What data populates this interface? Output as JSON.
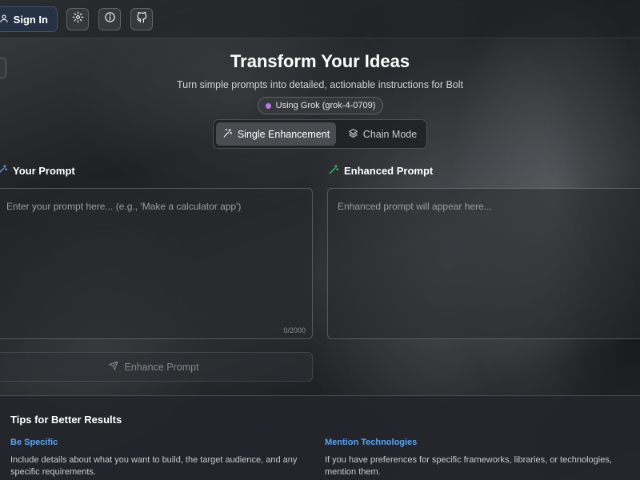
{
  "header": {
    "sign_in_label": "Sign In",
    "icons": [
      "user-icon",
      "settings-gear-icon",
      "info-icon",
      "github-icon"
    ]
  },
  "hero": {
    "title": "Transform Your Ideas",
    "subtitle": "Turn simple prompts into detailed, actionable instructions for Bolt",
    "model_badge": "Using Grok (grok-4-0709)",
    "model_dot_color": "#b47be8"
  },
  "modes": {
    "single": "Single Enhancement",
    "chain": "Chain Mode",
    "active": "single"
  },
  "input_panel": {
    "label": "Your Prompt",
    "placeholder": "Enter your prompt here... (e.g., 'Make a calculator app')",
    "value": "",
    "counter": "0/2000"
  },
  "output_panel": {
    "label": "Enhanced Prompt",
    "placeholder": "Enhanced prompt will appear here...",
    "value": ""
  },
  "enhance_button": {
    "label": "Enhance Prompt",
    "enabled": false
  },
  "tips": {
    "title": "Tips for Better Results",
    "items": [
      {
        "heading": "Be Specific",
        "body": "Include details about what you want to build, the target audience, and any specific requirements."
      },
      {
        "heading": "Mention Technologies",
        "body": "If you have preferences for specific frameworks, libraries, or technologies, mention them."
      }
    ]
  },
  "colors": {
    "accent_blue": "#5aa2f3",
    "sign_in_bg": "#253246",
    "wand_green": "#3fbf6f",
    "wand_blue": "#5aa2f3"
  }
}
